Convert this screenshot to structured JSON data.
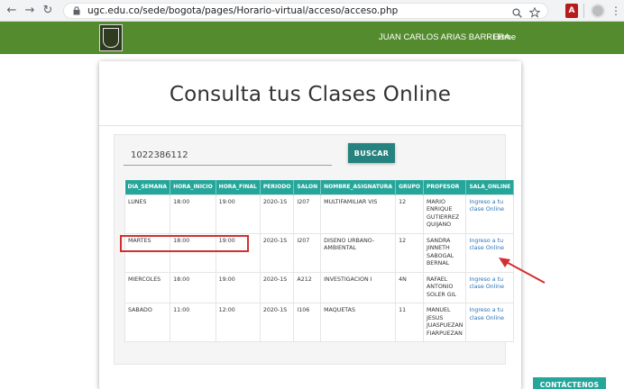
{
  "browser": {
    "url": "ugc.edu.co/sede/bogota/pages/Horario-virtual/acceso/acceso.php",
    "pdf_badge": "A"
  },
  "header": {
    "user_name": "JUAN CARLOS ARIAS BARRERA",
    "home_label": "- Home"
  },
  "page": {
    "title": "Consulta tus Clases Online"
  },
  "search": {
    "value": "1022386112",
    "button_label": "BUSCAR"
  },
  "table": {
    "columns": [
      "DIA_SEMANA",
      "HORA_INICIO",
      "HORA_FINAL",
      "PERIODO",
      "SALON",
      "NOMBRE_ASIGNATURA",
      "GRUPO",
      "PROFESOR",
      "SALA_ONLINE"
    ],
    "rows": [
      [
        "LUNES",
        "18:00",
        "19:00",
        "2020-1S",
        "I207",
        "MULTIFAMILIAR VIS",
        "12",
        "MARIO ENRIQUE GUTIERREZ QUIJANO",
        "Ingreso a tu clase Online"
      ],
      [
        "MARTES",
        "18:00",
        "19:00",
        "2020-1S",
        "I207",
        "DISENO URBANO-AMBIENTAL",
        "12",
        "SANDRA JINNETH SABOGAL BERNAL",
        "Ingreso a tu clase Online"
      ],
      [
        "MIERCOLES",
        "18:00",
        "19:00",
        "2020-1S",
        "A212",
        "INVESTIGACION I",
        "4N",
        "RAFAEL ANTONIO SOLER GIL",
        "Ingreso a tu clase Online"
      ],
      [
        "SABADO",
        "11:00",
        "12:00",
        "2020-1S",
        "I106",
        "MAQUETAS",
        "11",
        "MANUEL JESUS JUASPUEZAN FIARPUEZAN",
        "Ingreso a tu clase Online"
      ]
    ]
  },
  "footer": {
    "contact_label": "CONTÁCTENOS"
  },
  "colors": {
    "header_green": "#558b2f",
    "teal": "#26a69a",
    "link_blue": "#2b74b8",
    "annotation_red": "#d32f2f"
  }
}
